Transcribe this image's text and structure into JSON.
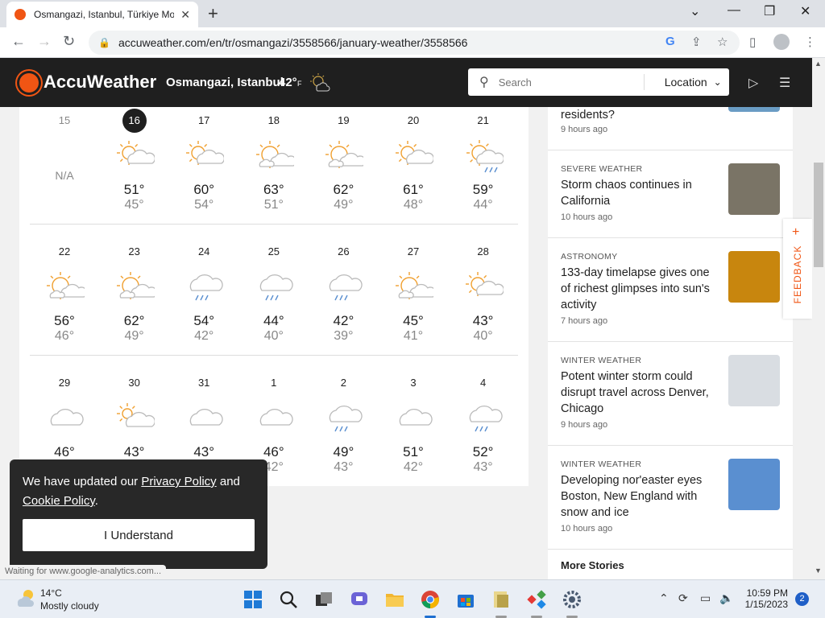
{
  "browser": {
    "tab_title": "Osmangazi, Istanbul, Türkiye Mo",
    "url": "accuweather.com/en/tr/osmangazi/3558566/january-weather/3558566"
  },
  "header": {
    "brand": "AccuWeather",
    "location": "Osmangazi, Istanbul",
    "temp": "42°",
    "unit": "F",
    "search_placeholder": "Search",
    "location_button": "Location"
  },
  "calendar": {
    "weeks": [
      [
        {
          "day": "15",
          "dim": true,
          "icon": "none",
          "hi": "",
          "lo": "N/A"
        },
        {
          "day": "16",
          "today": true,
          "icon": "sun-cloud",
          "hi": "51°",
          "lo": "45°"
        },
        {
          "day": "17",
          "icon": "sun-cloud",
          "hi": "60°",
          "lo": "54°"
        },
        {
          "day": "18",
          "icon": "sun-cloud-big",
          "hi": "63°",
          "lo": "51°"
        },
        {
          "day": "19",
          "icon": "sun-cloud-big",
          "hi": "62°",
          "lo": "49°"
        },
        {
          "day": "20",
          "icon": "sun-cloud",
          "hi": "61°",
          "lo": "48°"
        },
        {
          "day": "21",
          "icon": "sun-rain",
          "hi": "59°",
          "lo": "44°"
        }
      ],
      [
        {
          "day": "22",
          "icon": "sun-cloud-big",
          "hi": "56°",
          "lo": "46°"
        },
        {
          "day": "23",
          "icon": "sun-cloud-big",
          "hi": "62°",
          "lo": "49°"
        },
        {
          "day": "24",
          "icon": "rain",
          "hi": "54°",
          "lo": "42°"
        },
        {
          "day": "25",
          "icon": "rain",
          "hi": "44°",
          "lo": "40°"
        },
        {
          "day": "26",
          "icon": "rain",
          "hi": "42°",
          "lo": "39°"
        },
        {
          "day": "27",
          "icon": "sun-cloud-big",
          "hi": "45°",
          "lo": "41°"
        },
        {
          "day": "28",
          "icon": "sun-cloud",
          "hi": "43°",
          "lo": "40°"
        }
      ],
      [
        {
          "day": "29",
          "icon": "cloud",
          "hi": "46°",
          "lo": ""
        },
        {
          "day": "30",
          "icon": "sun-cloud-small",
          "hi": "43°",
          "lo": ""
        },
        {
          "day": "31",
          "icon": "cloud",
          "hi": "43°",
          "lo": ""
        },
        {
          "day": "1",
          "icon": "cloud",
          "hi": "46°",
          "lo": "42°"
        },
        {
          "day": "2",
          "icon": "rain",
          "hi": "49°",
          "lo": "43°"
        },
        {
          "day": "3",
          "icon": "cloud",
          "hi": "51°",
          "lo": "42°"
        },
        {
          "day": "4",
          "icon": "rain",
          "hi": "52°",
          "lo": "43°"
        }
      ]
    ]
  },
  "stories": [
    {
      "category": "",
      "headline": "residents?",
      "time": "9 hours ago",
      "thumb_color": "#6a9cc4"
    },
    {
      "category": "SEVERE WEATHER",
      "headline": "Storm chaos continues in California",
      "time": "10 hours ago",
      "thumb_color": "#7a7466"
    },
    {
      "category": "ASTRONOMY",
      "headline": "133-day timelapse gives one of richest glimpses into sun's activity",
      "time": "7 hours ago",
      "thumb_color": "#c8860e"
    },
    {
      "category": "WINTER WEATHER",
      "headline": "Potent winter storm could disrupt travel across Denver, Chicago",
      "time": "9 hours ago",
      "thumb_color": "#d9dde2"
    },
    {
      "category": "WINTER WEATHER",
      "headline": "Developing nor'easter eyes Boston, New England with snow and ice",
      "time": "10 hours ago",
      "thumb_color": "#5a8fd0"
    }
  ],
  "more_stories": "More Stories",
  "feedback_label": "FEEDBACK",
  "cookie": {
    "text_before": "We have updated our ",
    "privacy_link": "Privacy Policy",
    "text_middle": " and ",
    "cookie_link": "Cookie Policy",
    "text_after": ".",
    "button": "I Understand"
  },
  "status_text": "Waiting for www.google-analytics.com...",
  "taskbar": {
    "weather_temp": "14°C",
    "weather_cond": "Mostly cloudy",
    "time": "10:59 PM",
    "date": "1/15/2023",
    "notif_count": "2"
  },
  "colors": {
    "accent": "#f05514",
    "header_bg": "#1f1f1f"
  }
}
